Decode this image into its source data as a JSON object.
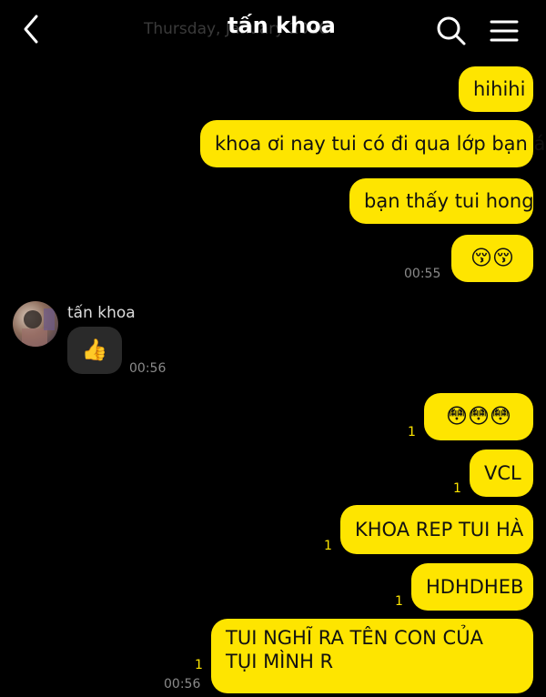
{
  "header": {
    "title": "tấn khoa",
    "date_text": "Thursday, January 2026",
    "icons": [
      "back-arrow-icon",
      "search-icon",
      "menu-icon"
    ]
  },
  "theme": {
    "bubble_color": "#fee500",
    "bg": "#000000",
    "incoming_bubble": "#2a2a2a"
  },
  "messages": [
    {
      "dir": "out",
      "text": "hihihi"
    },
    {
      "dir": "out",
      "text": "khoa ơi nay tui có đi qua lớp bạn á"
    },
    {
      "dir": "out",
      "text": "bạn thấy tui hong"
    },
    {
      "dir": "out",
      "text": "😚😚",
      "time": "00:55"
    },
    {
      "dir": "in",
      "sender": "tấn khoa",
      "text": "👍",
      "time": "00:56"
    },
    {
      "dir": "out",
      "text": "😳😳😳",
      "unread": "1"
    },
    {
      "dir": "out",
      "text": "VCL",
      "unread": "1"
    },
    {
      "dir": "out",
      "text": "KHOA REP TUI HÀ",
      "unread": "1"
    },
    {
      "dir": "out",
      "text": "HDHDHEB",
      "unread": "1"
    },
    {
      "dir": "out",
      "text": "TUI NGHĨ RA TÊN CON CỦA TỤI MÌNH R",
      "unread": "1",
      "time": "00:56"
    }
  ]
}
